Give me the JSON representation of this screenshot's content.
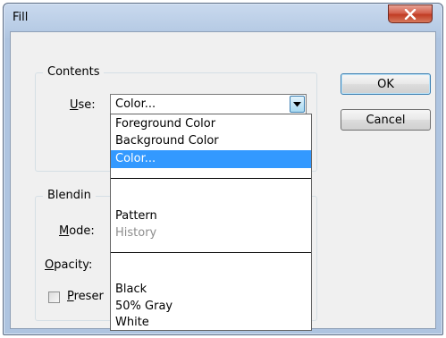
{
  "window": {
    "title": "Fill"
  },
  "contents_group": {
    "legend": "Contents",
    "use_label_prefix": "",
    "use_label_underlined": "U",
    "use_label_rest": "se:",
    "use_value": "Color..."
  },
  "dropdown": {
    "items": [
      {
        "label": "Foreground Color",
        "state": "normal"
      },
      {
        "label": "Background Color",
        "state": "normal"
      },
      {
        "label": "Color...",
        "state": "selected"
      },
      {
        "label": "Pattern",
        "state": "normal"
      },
      {
        "label": "History",
        "state": "disabled"
      },
      {
        "label": "Black",
        "state": "normal"
      },
      {
        "label": "50% Gray",
        "state": "normal"
      },
      {
        "label": "White",
        "state": "normal"
      }
    ]
  },
  "blending_group": {
    "legend_visible": "Blendin",
    "mode_label_underlined": "M",
    "mode_label_rest": "ode:",
    "opacity_label_underlined": "O",
    "opacity_label_rest": "pacity:",
    "preserve_label_underlined": "P",
    "preserve_label_rest": "reser"
  },
  "buttons": {
    "ok": "OK",
    "cancel": "Cancel"
  },
  "colors": {
    "selection": "#3399ff",
    "close_button": "#c13c24"
  },
  "icons": {
    "close": "close-x-icon",
    "dropdown_arrow": "chevron-down-icon"
  }
}
